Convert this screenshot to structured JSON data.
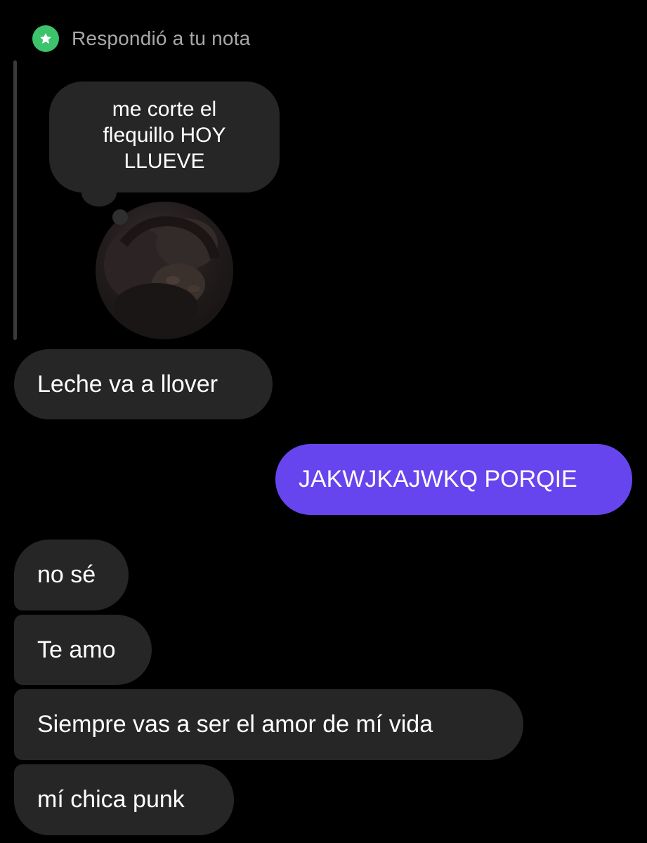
{
  "reply_header": {
    "icon": "star-icon",
    "label": "Respondió a tu nota"
  },
  "note": {
    "text_lines": [
      "me corte el",
      "flequillo HOY",
      "LLUEVE"
    ]
  },
  "avatar": {
    "icon": "profile-photo"
  },
  "messages": [
    {
      "text": "Leche va a llover",
      "direction": "incoming"
    },
    {
      "text": "JAKWJKAJWKQ PORQIE",
      "direction": "outgoing"
    },
    {
      "text": "no sé",
      "direction": "incoming"
    },
    {
      "text": "Te amo",
      "direction": "incoming"
    },
    {
      "text": "Siempre vas a ser el amor de mí vida",
      "direction": "incoming"
    },
    {
      "text": "mí chica punk",
      "direction": "incoming"
    }
  ],
  "colors": {
    "background": "#000000",
    "incoming_bubble": "#262626",
    "outgoing_bubble": "#6745ee",
    "badge_green": "#3cc36b",
    "secondary_text": "#a8a8a8"
  }
}
